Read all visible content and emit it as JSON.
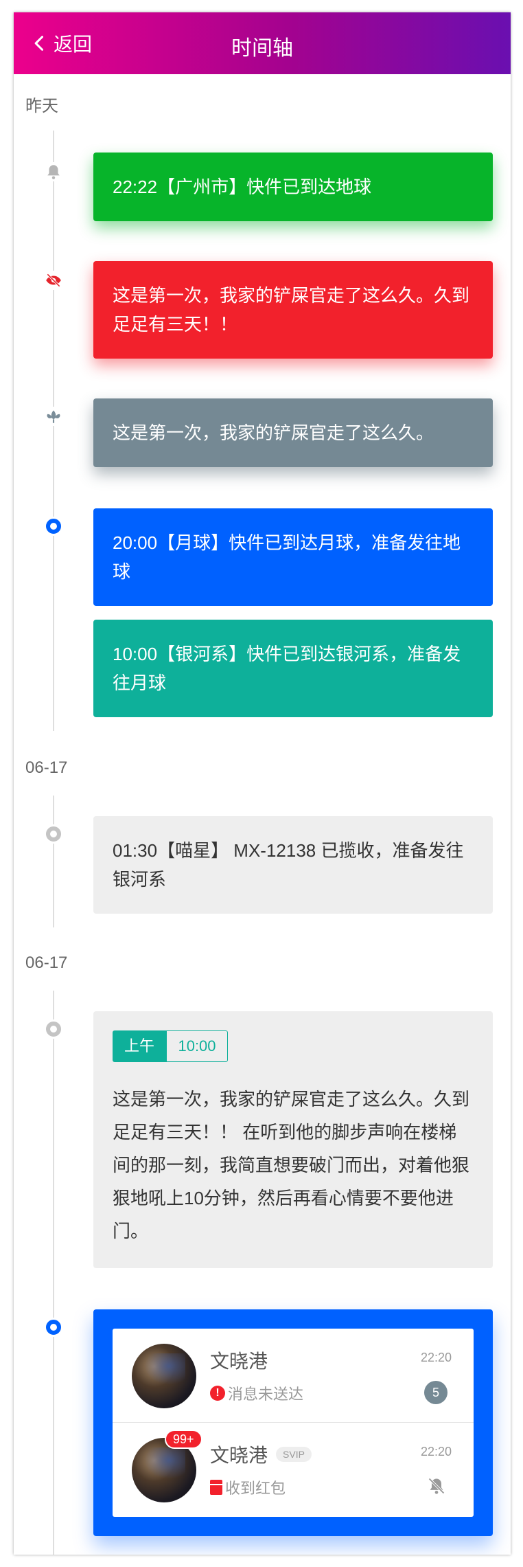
{
  "nav": {
    "back_label": "返回",
    "title": "时间轴"
  },
  "groups": [
    {
      "date": "昨天"
    },
    {
      "date": "06-17"
    },
    {
      "date": "06-17"
    }
  ],
  "items": {
    "item1": {
      "text": "22:22【广州市】快件已到达地球",
      "icon": "bell-icon",
      "color": "#07b42a"
    },
    "item2": {
      "text": "这是第一次，我家的铲屎官走了这么久。久到足足有三天！！",
      "icon": "eye-slash-icon",
      "color": "#f2212c"
    },
    "item3": {
      "text": "这是第一次，我家的铲屎官走了这么久。",
      "icon": "lotus-icon",
      "color": "#758994"
    },
    "item4": {
      "text": "20:00【月球】快件已到达月球，准备发往地球",
      "icon": "blue-dot-icon",
      "color": "#0061ff"
    },
    "item5": {
      "text": "10:00【银河系】快件已到达银河系，准备发往月球",
      "color": "#0eb09a"
    },
    "item6": {
      "text": "01:30【喵星】 MX-12138 已揽收，准备发往银河系",
      "icon": "gray-dot-icon"
    },
    "item7": {
      "tag_period": "上午",
      "tag_time": "10:00",
      "text": "这是第一次，我家的铲屎官走了这么久。久到足足有三天！！ 在听到他的脚步声响在楼梯间的那一刻，我简直想要破门而出，对着他狠狠地吼上10分钟，然后再看心情要不要他进门。",
      "icon": "gray-dot-icon"
    }
  },
  "chat": {
    "items": [
      {
        "name": "文晓港",
        "time": "22:20",
        "status": "消息未送达",
        "status_icon": "warning-icon",
        "count": "5"
      },
      {
        "name": "文晓港",
        "vip": "SVIP",
        "time": "22:20",
        "status": "收到红包",
        "status_icon": "red-packet-icon",
        "badge": "99+",
        "right_icon": "bell-muted-icon"
      }
    ]
  },
  "colors": {
    "accent": "#0061ff",
    "nav_start": "#ec008c",
    "nav_end": "#6a0fb0"
  }
}
